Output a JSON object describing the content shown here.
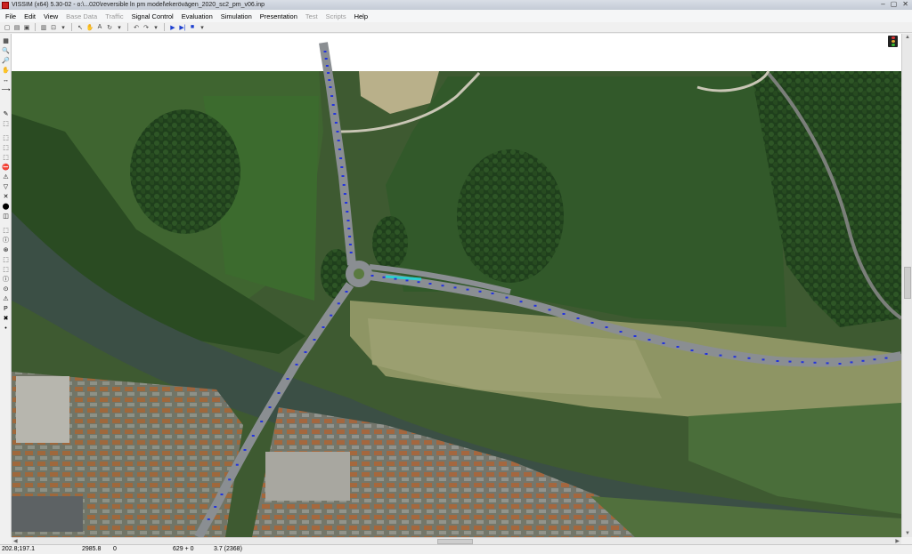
{
  "window": {
    "title": "VISSIM (x64) 5.30-02 - o:\\...020\\reversible ln pm model\\ekerövägen_2020_sc2_pm_v06.inp",
    "buttons": [
      "–",
      "▢",
      "✕"
    ]
  },
  "menu": [
    {
      "label": "File",
      "enabled": true
    },
    {
      "label": "Edit",
      "enabled": true
    },
    {
      "label": "View",
      "enabled": true
    },
    {
      "label": "Base Data",
      "enabled": false
    },
    {
      "label": "Traffic",
      "enabled": false
    },
    {
      "label": "Signal Control",
      "enabled": true
    },
    {
      "label": "Evaluation",
      "enabled": true
    },
    {
      "label": "Simulation",
      "enabled": true
    },
    {
      "label": "Presentation",
      "enabled": true
    },
    {
      "label": "Test",
      "enabled": false
    },
    {
      "label": "Scripts",
      "enabled": false
    },
    {
      "label": "Help",
      "enabled": true
    }
  ],
  "toolbar": {
    "glyphs": [
      "▢",
      "▤",
      "▣",
      "▥",
      "⊡",
      "▾",
      "↖",
      "✋",
      "A",
      "↻",
      "▾",
      "↶",
      "↷",
      "▾"
    ],
    "sim_glyphs": [
      "▶",
      "▶|",
      "■",
      "▾"
    ]
  },
  "left_tools": [
    "▦",
    "🔍",
    "🔎",
    "✋",
    "↔",
    "⟶",
    "✎",
    "⬚",
    "⬚",
    "⬚",
    "⬚",
    "⛔",
    "⚠",
    "▽",
    "✕",
    "⬤",
    "◫",
    "⬚",
    "ⓘ",
    "⊛",
    "⬚",
    "⬚",
    "ⓘ",
    "⊙",
    "⚠",
    "P",
    "✖",
    "•"
  ],
  "status": {
    "coords": "202.8;197.1",
    "value2": "2985.8",
    "value3": "0",
    "value4": "629 + 0",
    "value5": "3.7  (2368)"
  },
  "colors": {
    "vehicle": "#2233dd",
    "road": "#8a8e92",
    "water": "#3c5045",
    "field_dark": "#33572a",
    "field_light": "#8e9564"
  }
}
